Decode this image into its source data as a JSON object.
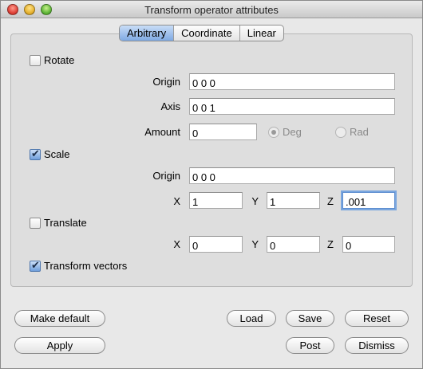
{
  "window": {
    "title": "Transform operator attributes"
  },
  "tabs": [
    {
      "label": "Arbitrary",
      "active": true
    },
    {
      "label": "Coordinate",
      "active": false
    },
    {
      "label": "Linear",
      "active": false
    }
  ],
  "rotate": {
    "label": "Rotate",
    "checked": false,
    "origin_label": "Origin",
    "origin_value": "0 0 0",
    "axis_label": "Axis",
    "axis_value": "0 0 1",
    "amount_label": "Amount",
    "amount_value": "0",
    "unit_deg_label": "Deg",
    "unit_rad_label": "Rad",
    "unit_selected": "Deg"
  },
  "scale": {
    "label": "Scale",
    "checked": true,
    "origin_label": "Origin",
    "origin_value": "0 0 0",
    "x_label": "X",
    "x_value": "1",
    "y_label": "Y",
    "y_value": "1",
    "z_label": "Z",
    "z_value": ".001"
  },
  "translate": {
    "label": "Translate",
    "checked": false,
    "x_label": "X",
    "x_value": "0",
    "y_label": "Y",
    "y_value": "0",
    "z_label": "Z",
    "z_value": "0"
  },
  "transform_vectors": {
    "label": "Transform vectors",
    "checked": true
  },
  "buttons": {
    "make_default": "Make default",
    "load": "Load",
    "save": "Save",
    "reset": "Reset",
    "apply": "Apply",
    "post": "Post",
    "dismiss": "Dismiss"
  },
  "colors": {
    "tab_active": "#7ea9e3",
    "checkbox_checked": "#6f9fdc",
    "focus_ring": "#7aa6de"
  }
}
